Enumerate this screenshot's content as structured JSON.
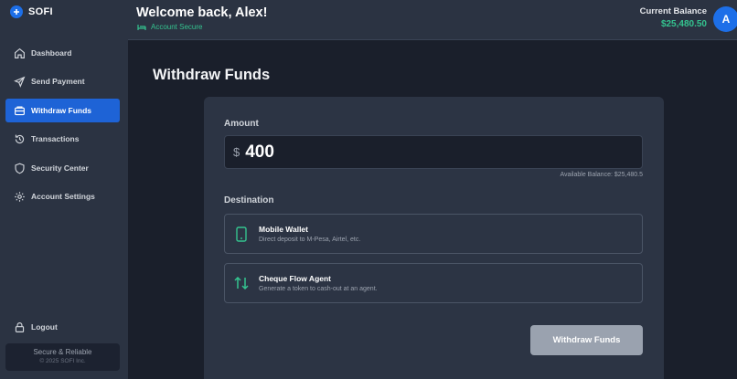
{
  "brand": {
    "name": "SOFI"
  },
  "sidebar": {
    "items": [
      {
        "label": "Dashboard",
        "icon": "home-icon"
      },
      {
        "label": "Send Payment",
        "icon": "send-icon"
      },
      {
        "label": "Withdraw Funds",
        "icon": "wallet-icon",
        "active": true
      },
      {
        "label": "Transactions",
        "icon": "history-icon"
      },
      {
        "label": "Security Center",
        "icon": "shield-icon"
      },
      {
        "label": "Account Settings",
        "icon": "gear-icon"
      }
    ],
    "logout_label": "Logout",
    "footer": {
      "title": "Secure & Reliable",
      "copyright": "© 2025 SOFI Inc."
    }
  },
  "header": {
    "welcome": "Welcome back, Alex!",
    "status": "Account Secure",
    "balance_label": "Current Balance",
    "balance_value": "$25,480.50",
    "avatar_initial": "A"
  },
  "main": {
    "title": "Withdraw Funds",
    "amount_label": "Amount",
    "currency_symbol": "$",
    "amount_value": "400",
    "available_balance": "Available Balance: $25,480.5",
    "destination_label": "Destination",
    "options": [
      {
        "title": "Mobile Wallet",
        "description": "Direct deposit to M-Pesa, Airtel, etc.",
        "icon": "phone-icon"
      },
      {
        "title": "Cheque Flow Agent",
        "description": "Generate a token to cash-out at an agent.",
        "icon": "transfer-arrows-icon"
      }
    ],
    "submit_label": "Withdraw Funds"
  },
  "colors": {
    "accent": "#1e63d6",
    "success": "#34c38f",
    "background": "#1a1f2b",
    "panel": "#2b3342"
  }
}
